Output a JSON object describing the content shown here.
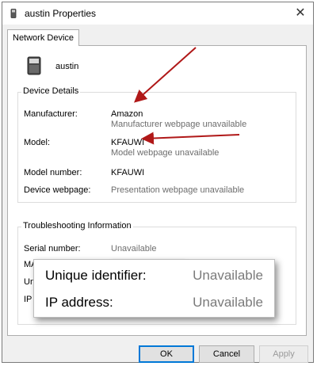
{
  "window": {
    "title": "austin Properties",
    "close_glyph": "✕"
  },
  "tabs": [
    {
      "label": "Network Device",
      "selected": true
    }
  ],
  "device": {
    "name": "austin",
    "icon": "network-device-icon"
  },
  "device_details": {
    "heading": "Device Details",
    "manufacturer_label": "Manufacturer:",
    "manufacturer_value": "Amazon",
    "manufacturer_sub": "Manufacturer webpage unavailable",
    "model_label": "Model:",
    "model_value": "KFAUWI",
    "model_sub": "Model webpage unavailable",
    "model_number_label": "Model number:",
    "model_number_value": "KFAUWI",
    "webpage_label": "Device webpage:",
    "webpage_value": "Presentation webpage unavailable"
  },
  "troubleshooting": {
    "heading": "Troubleshooting Information",
    "serial_label": "Serial number:",
    "serial_value": "Unavailable",
    "mac_label": "MAC address:",
    "uid_label_partial": "Uni",
    "ip_label_partial": "IP a"
  },
  "callout": {
    "uid_label": "Unique identifier:",
    "uid_value": "Unavailable",
    "ip_label": "IP address:",
    "ip_value": "Unavailable"
  },
  "buttons": {
    "ok": "OK",
    "cancel": "Cancel",
    "apply": "Apply"
  },
  "colors": {
    "arrow": "#b01818",
    "accent": "#0078d7"
  }
}
